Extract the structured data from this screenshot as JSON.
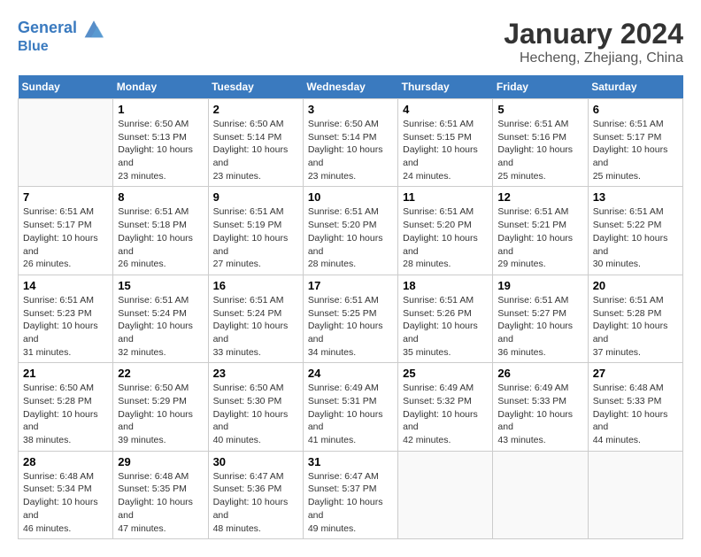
{
  "header": {
    "logo_line1": "General",
    "logo_line2": "Blue",
    "month_year": "January 2024",
    "location": "Hecheng, Zhejiang, China"
  },
  "weekdays": [
    "Sunday",
    "Monday",
    "Tuesday",
    "Wednesday",
    "Thursday",
    "Friday",
    "Saturday"
  ],
  "weeks": [
    [
      {
        "day": "",
        "sunrise": "",
        "sunset": "",
        "daylight": ""
      },
      {
        "day": "1",
        "sunrise": "6:50 AM",
        "sunset": "5:13 PM",
        "daylight": "10 hours and 23 minutes."
      },
      {
        "day": "2",
        "sunrise": "6:50 AM",
        "sunset": "5:14 PM",
        "daylight": "10 hours and 23 minutes."
      },
      {
        "day": "3",
        "sunrise": "6:50 AM",
        "sunset": "5:14 PM",
        "daylight": "10 hours and 23 minutes."
      },
      {
        "day": "4",
        "sunrise": "6:51 AM",
        "sunset": "5:15 PM",
        "daylight": "10 hours and 24 minutes."
      },
      {
        "day": "5",
        "sunrise": "6:51 AM",
        "sunset": "5:16 PM",
        "daylight": "10 hours and 25 minutes."
      },
      {
        "day": "6",
        "sunrise": "6:51 AM",
        "sunset": "5:17 PM",
        "daylight": "10 hours and 25 minutes."
      }
    ],
    [
      {
        "day": "7",
        "sunrise": "6:51 AM",
        "sunset": "5:17 PM",
        "daylight": "10 hours and 26 minutes."
      },
      {
        "day": "8",
        "sunrise": "6:51 AM",
        "sunset": "5:18 PM",
        "daylight": "10 hours and 26 minutes."
      },
      {
        "day": "9",
        "sunrise": "6:51 AM",
        "sunset": "5:19 PM",
        "daylight": "10 hours and 27 minutes."
      },
      {
        "day": "10",
        "sunrise": "6:51 AM",
        "sunset": "5:20 PM",
        "daylight": "10 hours and 28 minutes."
      },
      {
        "day": "11",
        "sunrise": "6:51 AM",
        "sunset": "5:20 PM",
        "daylight": "10 hours and 28 minutes."
      },
      {
        "day": "12",
        "sunrise": "6:51 AM",
        "sunset": "5:21 PM",
        "daylight": "10 hours and 29 minutes."
      },
      {
        "day": "13",
        "sunrise": "6:51 AM",
        "sunset": "5:22 PM",
        "daylight": "10 hours and 30 minutes."
      }
    ],
    [
      {
        "day": "14",
        "sunrise": "6:51 AM",
        "sunset": "5:23 PM",
        "daylight": "10 hours and 31 minutes."
      },
      {
        "day": "15",
        "sunrise": "6:51 AM",
        "sunset": "5:24 PM",
        "daylight": "10 hours and 32 minutes."
      },
      {
        "day": "16",
        "sunrise": "6:51 AM",
        "sunset": "5:24 PM",
        "daylight": "10 hours and 33 minutes."
      },
      {
        "day": "17",
        "sunrise": "6:51 AM",
        "sunset": "5:25 PM",
        "daylight": "10 hours and 34 minutes."
      },
      {
        "day": "18",
        "sunrise": "6:51 AM",
        "sunset": "5:26 PM",
        "daylight": "10 hours and 35 minutes."
      },
      {
        "day": "19",
        "sunrise": "6:51 AM",
        "sunset": "5:27 PM",
        "daylight": "10 hours and 36 minutes."
      },
      {
        "day": "20",
        "sunrise": "6:51 AM",
        "sunset": "5:28 PM",
        "daylight": "10 hours and 37 minutes."
      }
    ],
    [
      {
        "day": "21",
        "sunrise": "6:50 AM",
        "sunset": "5:28 PM",
        "daylight": "10 hours and 38 minutes."
      },
      {
        "day": "22",
        "sunrise": "6:50 AM",
        "sunset": "5:29 PM",
        "daylight": "10 hours and 39 minutes."
      },
      {
        "day": "23",
        "sunrise": "6:50 AM",
        "sunset": "5:30 PM",
        "daylight": "10 hours and 40 minutes."
      },
      {
        "day": "24",
        "sunrise": "6:49 AM",
        "sunset": "5:31 PM",
        "daylight": "10 hours and 41 minutes."
      },
      {
        "day": "25",
        "sunrise": "6:49 AM",
        "sunset": "5:32 PM",
        "daylight": "10 hours and 42 minutes."
      },
      {
        "day": "26",
        "sunrise": "6:49 AM",
        "sunset": "5:33 PM",
        "daylight": "10 hours and 43 minutes."
      },
      {
        "day": "27",
        "sunrise": "6:48 AM",
        "sunset": "5:33 PM",
        "daylight": "10 hours and 44 minutes."
      }
    ],
    [
      {
        "day": "28",
        "sunrise": "6:48 AM",
        "sunset": "5:34 PM",
        "daylight": "10 hours and 46 minutes."
      },
      {
        "day": "29",
        "sunrise": "6:48 AM",
        "sunset": "5:35 PM",
        "daylight": "10 hours and 47 minutes."
      },
      {
        "day": "30",
        "sunrise": "6:47 AM",
        "sunset": "5:36 PM",
        "daylight": "10 hours and 48 minutes."
      },
      {
        "day": "31",
        "sunrise": "6:47 AM",
        "sunset": "5:37 PM",
        "daylight": "10 hours and 49 minutes."
      },
      {
        "day": "",
        "sunrise": "",
        "sunset": "",
        "daylight": ""
      },
      {
        "day": "",
        "sunrise": "",
        "sunset": "",
        "daylight": ""
      },
      {
        "day": "",
        "sunrise": "",
        "sunset": "",
        "daylight": ""
      }
    ]
  ],
  "labels": {
    "sunrise_prefix": "Sunrise: ",
    "sunset_prefix": "Sunset: ",
    "daylight_prefix": "Daylight: "
  }
}
